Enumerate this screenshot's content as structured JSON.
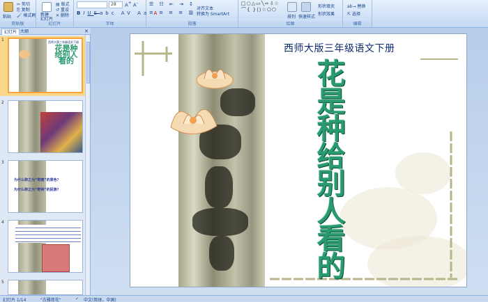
{
  "ribbon": {
    "groups": [
      {
        "id": "clipboard",
        "label": "剪贴板"
      },
      {
        "id": "slides",
        "label": "幻灯片"
      },
      {
        "id": "font",
        "label": "字体"
      },
      {
        "id": "paragraph",
        "label": "段落"
      },
      {
        "id": "drawing",
        "label": "绘图"
      },
      {
        "id": "editing",
        "label": "编辑"
      }
    ],
    "paste_label": "粘贴",
    "cut_label": "剪切",
    "copy_label": "复制",
    "format_painter_label": "格式刷",
    "new_slide_label": "新建\n幻灯片",
    "layout_label": "版式",
    "reset_label": "重设",
    "delete_label": "删除",
    "font_size": "28",
    "align_text_label": "对齐文本",
    "smartart_label": "转换为 SmartArt",
    "arrange_label": "排列",
    "quick_styles_label": "快速样式",
    "shape_fill_label": "形状填充",
    "shape_effects_label": "形状效果",
    "replace_label": "替换",
    "select_label": "选择"
  },
  "pane": {
    "tab_slides": "幻灯片",
    "tab_outline": "大纲",
    "thumbs": [
      {
        "num": "1",
        "title": "花是种给别人看的"
      },
      {
        "num": "2"
      },
      {
        "num": "3",
        "lines": [
          "为什么称之为“奇丽”的景色？",
          "为什么称之为“奇特”的民族？"
        ]
      },
      {
        "num": "4"
      },
      {
        "num": "5"
      }
    ]
  },
  "slide": {
    "subtitle": "西师大版三年级语文下册",
    "title_chars": [
      "花",
      "是",
      "种",
      "给",
      "别",
      "人",
      "看",
      "的"
    ]
  },
  "status": {
    "slide_pos": "幻灯片 1/14",
    "theme": "\"古雅荷花\"",
    "language": "中文(简体，中国)"
  },
  "colors": {
    "title_green": "#2a9a70",
    "subtitle_blue": "#0b2a6e",
    "selection_orange": "#f7a43f"
  }
}
